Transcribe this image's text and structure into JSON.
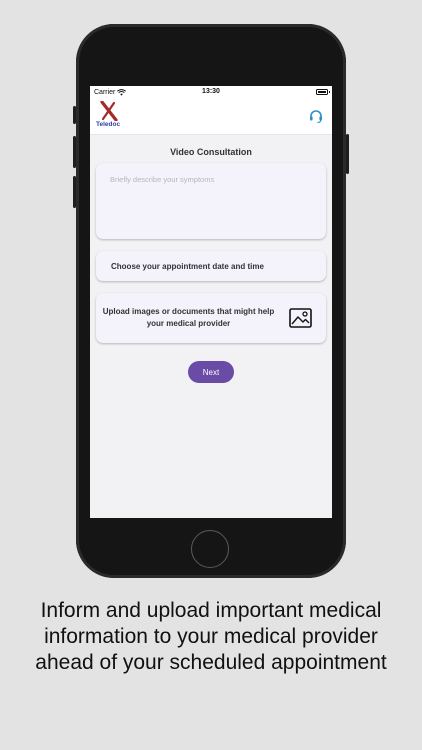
{
  "status_bar": {
    "carrier": "Carrier",
    "time": "13:30"
  },
  "app_bar": {
    "logo_text": "Teledoc",
    "support_icon": "headset-icon"
  },
  "page": {
    "title": "Video Consultation",
    "symptoms_placeholder": "Briefly describe your symptoms",
    "date_label": "Choose your appointment date and time",
    "upload_label": "Upload images or documents that might help your medical provider",
    "upload_icon": "image-icon",
    "next_label": "Next"
  },
  "caption": "Inform and upload important medical information to your medical provider ahead of your scheduled appointment",
  "colors": {
    "accent": "#6a4ba6",
    "logo_red": "#a52a2a",
    "logo_blue": "#2f3e9e",
    "support_icon": "#2a8fc7",
    "background": "#e3e3e3"
  }
}
